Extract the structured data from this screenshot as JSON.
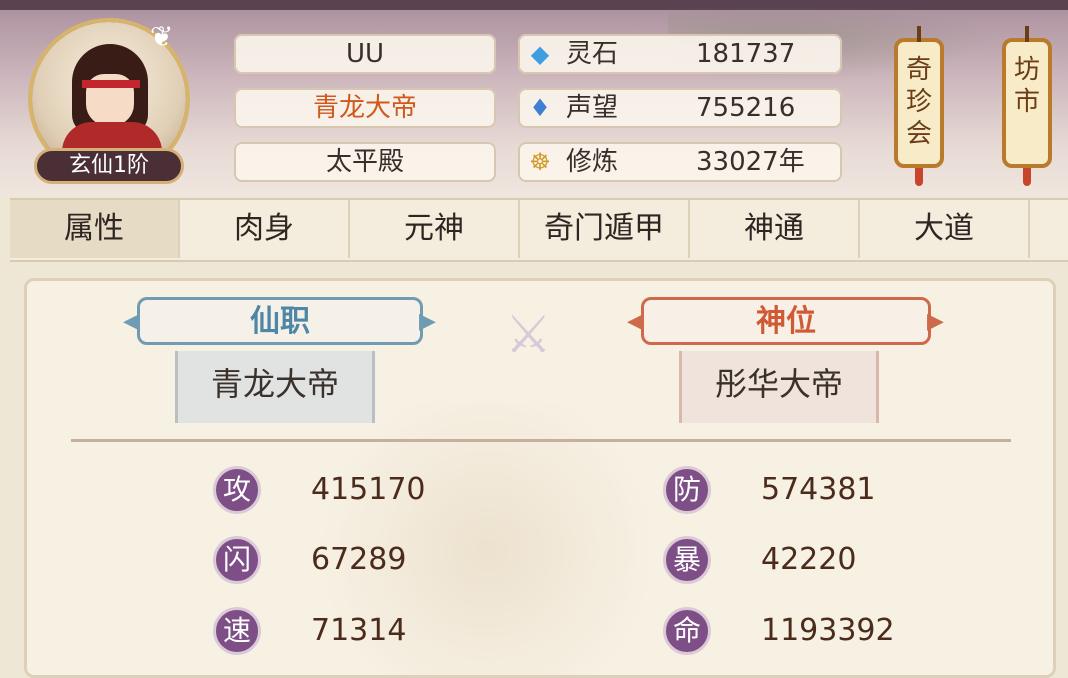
{
  "header": {
    "rank_badge": "玄仙1阶",
    "player_name": "UU",
    "title": "青龙大帝",
    "faction": "太平殿",
    "resources": [
      {
        "icon": "spirit-stone-icon",
        "label": "灵石",
        "value": "181737"
      },
      {
        "icon": "reputation-icon",
        "label": "声望",
        "value": "755216"
      },
      {
        "icon": "cultivation-icon",
        "label": "修炼",
        "value": "33027年"
      }
    ],
    "lanterns": [
      {
        "label": "奇珍会"
      },
      {
        "label": "坊市"
      }
    ]
  },
  "tabs": [
    {
      "label": "属性",
      "active": true
    },
    {
      "label": "肉身"
    },
    {
      "label": "元神"
    },
    {
      "label": "奇门遁甲"
    },
    {
      "label": "神通"
    },
    {
      "label": "大道"
    }
  ],
  "panel": {
    "xian_zhi": {
      "label": "仙职",
      "value": "青龙大帝"
    },
    "shen_wei": {
      "label": "神位",
      "value": "彤华大帝"
    },
    "stats_left": [
      {
        "icon": "攻",
        "value": "415170"
      },
      {
        "icon": "闪",
        "value": "67289"
      },
      {
        "icon": "速",
        "value": "71314"
      }
    ],
    "stats_right": [
      {
        "icon": "防",
        "value": "574381"
      },
      {
        "icon": "暴",
        "value": "42220"
      },
      {
        "icon": "命",
        "value": "1193392"
      }
    ]
  }
}
